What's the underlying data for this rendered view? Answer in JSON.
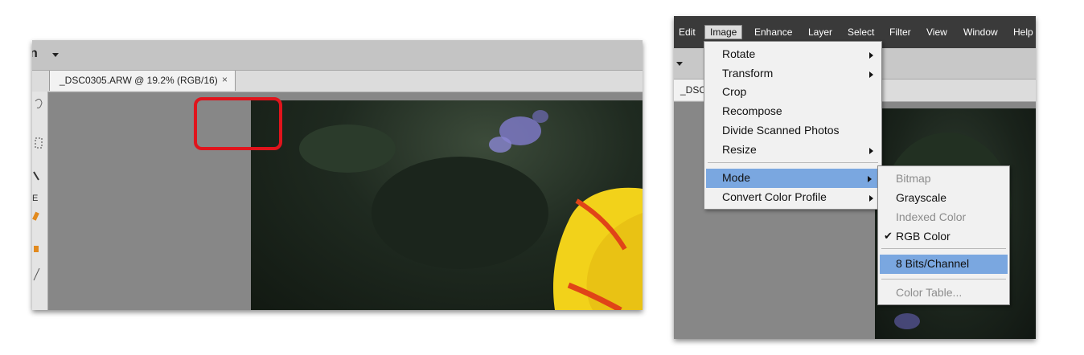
{
  "left": {
    "options_fragment": "n",
    "tab_title": "_DSC0305.ARW @ 19.2% (RGB/16)",
    "tab_close": "×"
  },
  "right": {
    "menubar": [
      "Edit",
      "Image",
      "Enhance",
      "Layer",
      "Select",
      "Filter",
      "View",
      "Window",
      "Help"
    ],
    "active_menu": "Image",
    "tab_title": "_DSC",
    "image_menu": [
      {
        "label": "Rotate",
        "submenu": true
      },
      {
        "label": "Transform",
        "submenu": true
      },
      {
        "label": "Crop",
        "submenu": false
      },
      {
        "label": "Recompose",
        "submenu": false
      },
      {
        "label": "Divide Scanned Photos",
        "submenu": false
      },
      {
        "label": "Resize",
        "submenu": true
      },
      {
        "label": "Mode",
        "submenu": true,
        "highlighted": true
      },
      {
        "label": "Convert Color Profile",
        "submenu": true
      }
    ],
    "mode_menu": [
      {
        "label": "Bitmap",
        "state": "disabled"
      },
      {
        "label": "Grayscale",
        "state": "enabled"
      },
      {
        "label": "Indexed Color",
        "state": "disabled"
      },
      {
        "label": "RGB Color",
        "state": "checked"
      },
      {
        "label": "8 Bits/Channel",
        "state": "highlighted"
      },
      {
        "label": "Color Table...",
        "state": "disabled"
      }
    ],
    "check_mark": "✔"
  },
  "colors": {
    "highlight_frame": "#e0141c",
    "menu_highlight": "#7aa7e0",
    "menubar_bg": "#3a3a3a"
  }
}
